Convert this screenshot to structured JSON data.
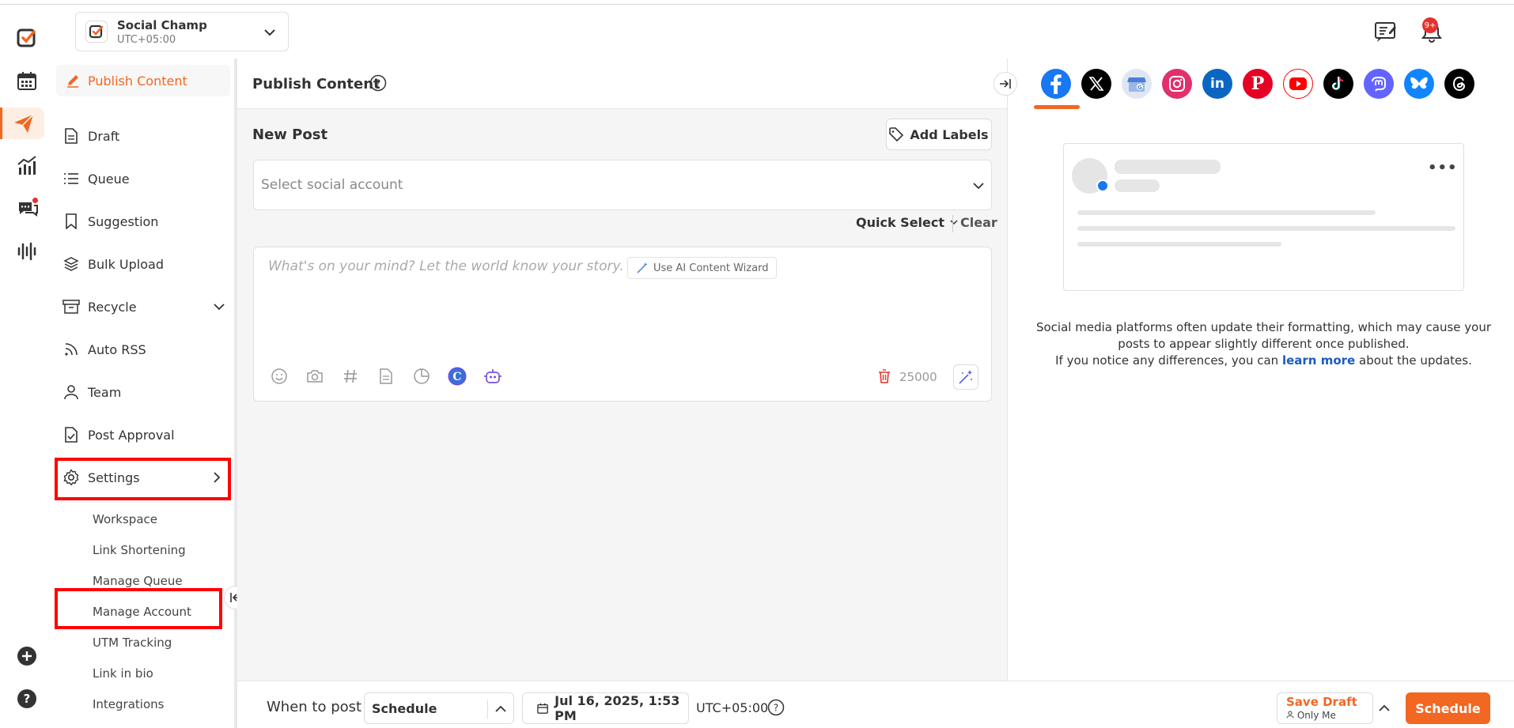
{
  "workspace": {
    "name": "Social Champ",
    "timezone": "UTC+05:00"
  },
  "notifications": {
    "badge": "9+"
  },
  "sidebar": {
    "header": "Publish Content",
    "items": [
      {
        "label": "Draft"
      },
      {
        "label": "Queue"
      },
      {
        "label": "Suggestion"
      },
      {
        "label": "Bulk Upload"
      },
      {
        "label": "Recycle"
      },
      {
        "label": "Auto RSS"
      },
      {
        "label": "Team"
      },
      {
        "label": "Post Approval"
      },
      {
        "label": "Settings"
      }
    ],
    "settings_sub": [
      {
        "label": "Workspace"
      },
      {
        "label": "Link Shortening"
      },
      {
        "label": "Manage Queue"
      },
      {
        "label": "Manage Account"
      },
      {
        "label": "UTM Tracking"
      },
      {
        "label": "Link in bio"
      },
      {
        "label": "Integrations"
      }
    ]
  },
  "main": {
    "title": "Publish Content",
    "new_post": "New Post",
    "add_labels": "Add Labels",
    "select_account_placeholder": "Select social account",
    "quick_select": "Quick Select",
    "clear": "Clear",
    "composer_placeholder": "What's on your mind? Let the world know your story.",
    "ai_wizard": "Use AI Content Wizard",
    "char_count": "25000"
  },
  "bottom": {
    "when_to_post": "When to post",
    "schedule_mode": "Schedule",
    "datetime": "Jul 16, 2025, 1:53 PM",
    "timezone": "UTC+05:00",
    "save_draft": "Save Draft",
    "visibility": "Only Me",
    "schedule_button": "Schedule"
  },
  "preview": {
    "networks": [
      "facebook",
      "x",
      "google-business",
      "instagram",
      "linkedin",
      "pinterest",
      "youtube",
      "tiktok",
      "mastodon",
      "bluesky",
      "threads"
    ],
    "note_line1": "Social media platforms often update their formatting, which may cause your posts to appear slightly different once published.",
    "note_line2_a": "If you notice any differences, you can",
    "note_link": "learn more",
    "note_line2_b": "about the updates."
  },
  "colors": {
    "accent": "#f26722",
    "link": "#1d5bbf",
    "alert": "#e5322d"
  }
}
